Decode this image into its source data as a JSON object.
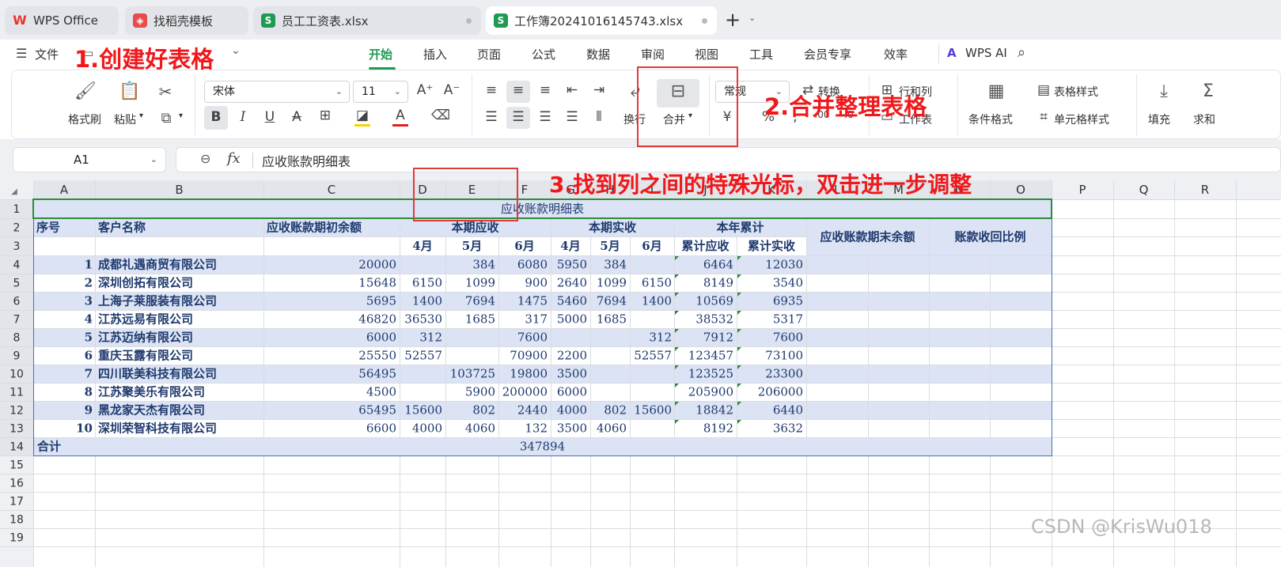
{
  "tabs": [
    {
      "label": "WPS Office",
      "icon": "wps-logo-icon",
      "color": "#e6372b"
    },
    {
      "label": "找稻壳模板",
      "icon": "docer-icon",
      "color": "#e84b4b"
    },
    {
      "label": "员工工资表.xlsx",
      "icon": "spreadsheet-icon",
      "color": "#1f9a53",
      "icon_text": "S"
    },
    {
      "label": "工作簿20241016145743.xlsx",
      "icon": "spreadsheet-icon",
      "color": "#1f9a53",
      "icon_text": "S"
    }
  ],
  "new_tab": "+",
  "menu": {
    "file": "文件",
    "items": [
      "开始",
      "插入",
      "页面",
      "公式",
      "数据",
      "审阅",
      "视图",
      "工具",
      "会员专享",
      "效率"
    ],
    "active": "开始",
    "ai": "WPS AI"
  },
  "ribbon": {
    "format_painter": "格式刷",
    "paste": "粘贴",
    "font_name": "宋体",
    "font_size": "11",
    "wrap": "换行",
    "merge": "合并",
    "number_format": "常规",
    "convert": "转换",
    "rows_cols": "行和列",
    "worksheet": "工作表",
    "cond_format": "条件格式",
    "table_style": "表格样式",
    "cell_style": "单元格样式",
    "fill": "填充",
    "sum": "求和",
    "currency": "¥",
    "percent": "%"
  },
  "formula": {
    "cell_ref": "A1",
    "fx": "fx",
    "value": "应收账款明细表"
  },
  "columns": [
    "A",
    "B",
    "C",
    "D",
    "E",
    "F",
    "G",
    "H",
    "I",
    "J",
    "K",
    "L",
    "M",
    "N",
    "O",
    "P",
    "Q",
    "R"
  ],
  "rows": [
    "1",
    "2",
    "3",
    "4",
    "5",
    "6",
    "7",
    "8",
    "9",
    "10",
    "11",
    "12",
    "13",
    "14",
    "15",
    "16",
    "17",
    "18",
    "19"
  ],
  "table": {
    "title": "应收账款明细表",
    "headers": {
      "seq": "序号",
      "customer": "客户名称",
      "opening": "应收账款期初余额",
      "period_receivable": "本期应收",
      "period_received": "本期实收",
      "ytd": "本年累计",
      "closing": "应收账款期末余额",
      "ratio": "账款收回比例",
      "months": [
        "4月",
        "5月",
        "6月",
        "4月",
        "5月",
        "6月"
      ],
      "ytd_sub": [
        "累计应收",
        "累计实收"
      ]
    },
    "rows": [
      [
        "1",
        "成都礼遇商贸有限公司",
        "20000",
        "",
        "384",
        "6080",
        "5950",
        "384",
        "",
        "6464",
        "12030"
      ],
      [
        "2",
        "深圳创拓有限公司",
        "15648",
        "6150",
        "1099",
        "900",
        "2640",
        "1099",
        "6150",
        "8149",
        "3540"
      ],
      [
        "3",
        "上海子莱服装有限公司",
        "5695",
        "1400",
        "7694",
        "1475",
        "5460",
        "7694",
        "1400",
        "10569",
        "6935"
      ],
      [
        "4",
        "江苏远易有限公司",
        "46820",
        "36530",
        "1685",
        "317",
        "5000",
        "1685",
        "",
        "38532",
        "5317"
      ],
      [
        "5",
        "江苏迈纳有限公司",
        "6000",
        "312",
        "",
        "7600",
        "",
        "",
        "312",
        "7912",
        "7600"
      ],
      [
        "6",
        "重庆玉露有限公司",
        "25550",
        "52557",
        "",
        "70900",
        "2200",
        "",
        "52557",
        "123457",
        "73100"
      ],
      [
        "7",
        "四川联美科技有限公司",
        "56495",
        "",
        "103725",
        "19800",
        "3500",
        "",
        "",
        "123525",
        "23300"
      ],
      [
        "8",
        "江苏聚美乐有限公司",
        "4500",
        "",
        "5900",
        "200000",
        "6000",
        "",
        "",
        "205900",
        "206000"
      ],
      [
        "9",
        "黑龙家天杰有限公司",
        "65495",
        "15600",
        "802",
        "2440",
        "4000",
        "802",
        "15600",
        "18842",
        "6440"
      ],
      [
        "10",
        "深圳荣智科技有限公司",
        "6600",
        "4000",
        "4060",
        "132",
        "3500",
        "4060",
        "",
        "8192",
        "3632"
      ]
    ],
    "total_label": "合计",
    "total_value": "347894"
  },
  "annotations": {
    "step1": "1.创建好表格",
    "step2": "2.合并整理表格",
    "step3": "3.找到列之间的特殊光标，双击进一步调整"
  },
  "watermark": "CSDN @KrisWu018",
  "colors": {
    "accent": "#1f9a53",
    "band": "#dbe3f4",
    "text_navy": "#1f3a6e",
    "annotation": "#f0181b"
  }
}
